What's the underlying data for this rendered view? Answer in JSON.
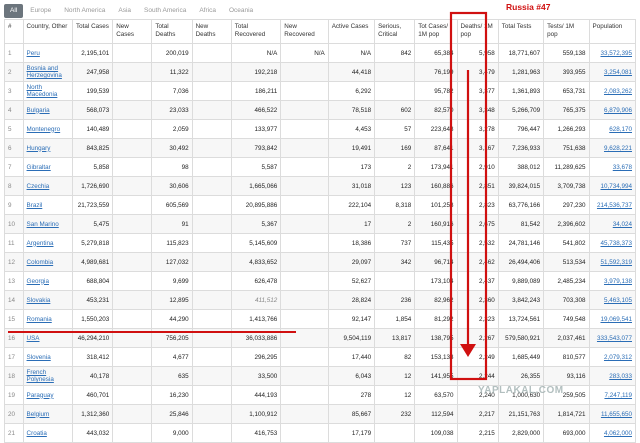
{
  "tabs": [
    {
      "label": "All",
      "active": true
    },
    {
      "label": "Europe"
    },
    {
      "label": "North America"
    },
    {
      "label": "Asia"
    },
    {
      "label": "South America"
    },
    {
      "label": "Africa"
    },
    {
      "label": "Oceania"
    }
  ],
  "annotation": {
    "label": "Russia #47",
    "color": "#d01010"
  },
  "watermark": "YAPLAKAL.COM",
  "table": {
    "headers": [
      "#",
      "Country, Other",
      "Total Cases",
      "New Cases",
      "Total Deaths",
      "New Deaths",
      "Total Recovered",
      "New Recovered",
      "Active Cases",
      "Serious, Critical",
      "Tot Cases/ 1M pop",
      "Deaths/ 1M pop",
      "Total Tests",
      "Tests/ 1M pop",
      "Population"
    ],
    "rows": [
      [
        "1",
        "Peru",
        "2,195,101",
        "",
        "200,019",
        "",
        "N/A",
        "N/A",
        "N/A",
        "842",
        "65,384",
        "5,958",
        "18,771,607",
        "559,138",
        "33,572,395"
      ],
      [
        "2",
        "Bosnia and Herzegovina",
        "247,958",
        "",
        "11,322",
        "",
        "192,218",
        "",
        "44,418",
        "",
        "76,199",
        "3,479",
        "1,281,963",
        "393,955",
        "3,254,081"
      ],
      [
        "3",
        "North Macedonia",
        "199,539",
        "",
        "7,036",
        "",
        "186,211",
        "",
        "6,292",
        "",
        "95,782",
        "3,377",
        "1,361,893",
        "653,731",
        "2,083,262"
      ],
      [
        "4",
        "Bulgaria",
        "568,073",
        "",
        "23,033",
        "",
        "466,522",
        "",
        "78,518",
        "602",
        "82,570",
        "3,348",
        "5,266,709",
        "765,375",
        "6,879,906"
      ],
      [
        "5",
        "Montenegro",
        "140,489",
        "",
        "2,059",
        "",
        "133,977",
        "",
        "4,453",
        "57",
        "223,648",
        "3,278",
        "796,447",
        "1,266,293",
        "628,170"
      ],
      [
        "6",
        "Hungary",
        "843,825",
        "",
        "30,492",
        "",
        "793,842",
        "",
        "19,491",
        "169",
        "87,641",
        "3,167",
        "7,236,933",
        "751,638",
        "9,628,221"
      ],
      [
        "7",
        "Gibraltar",
        "5,858",
        "",
        "98",
        "",
        "5,587",
        "",
        "173",
        "2",
        "173,941",
        "2,910",
        "388,012",
        "11,289,625",
        "33,678"
      ],
      [
        "8",
        "Czechia",
        "1,726,690",
        "",
        "30,606",
        "",
        "1,665,066",
        "",
        "31,018",
        "123",
        "160,886",
        "2,851",
        "39,824,015",
        "3,709,738",
        "10,734,994"
      ],
      [
        "9",
        "Brazil",
        "21,723,559",
        "",
        "605,569",
        "",
        "20,895,886",
        "",
        "222,104",
        "8,318",
        "101,258",
        "2,823",
        "63,776,166",
        "297,230",
        "214,536,737"
      ],
      [
        "10",
        "San Marino",
        "5,475",
        "",
        "91",
        "",
        "5,367",
        "",
        "17",
        "2",
        "160,916",
        "2,675",
        "81,542",
        "2,396,602",
        "34,024"
      ],
      [
        "11",
        "Argentina",
        "5,279,818",
        "",
        "115,823",
        "",
        "5,145,609",
        "",
        "18,386",
        "737",
        "115,435",
        "2,532",
        "24,781,146",
        "541,802",
        "45,738,373"
      ],
      [
        "12",
        "Colombia",
        "4,989,681",
        "",
        "127,032",
        "",
        "4,833,652",
        "",
        "29,097",
        "342",
        "96,714",
        "2,462",
        "26,494,406",
        "513,534",
        "51,592,319"
      ],
      [
        "13",
        "Georgia",
        "688,804",
        "",
        "9,699",
        "",
        "626,478",
        "",
        "52,627",
        "",
        "173,104",
        "2,437",
        "9,889,089",
        "2,485,234",
        "3,979,138"
      ],
      [
        "14",
        "Slovakia",
        "453,231",
        "",
        "12,895",
        "",
        "411,512",
        "",
        "28,824",
        "236",
        "82,962",
        "2,360",
        "3,842,243",
        "703,308",
        "5,463,105"
      ],
      [
        "15",
        "Romania",
        "1,550,203",
        "",
        "44,290",
        "",
        "1,413,766",
        "",
        "92,147",
        "1,854",
        "81,292",
        "2,323",
        "13,724,561",
        "749,548",
        "19,069,541"
      ],
      [
        "16",
        "USA",
        "46,294,210",
        "",
        "756,205",
        "",
        "36,033,886",
        "",
        "9,504,119",
        "13,817",
        "138,795",
        "2,267",
        "579,580,921",
        "2,037,461",
        "333,543,077"
      ],
      [
        "17",
        "Slovenia",
        "318,412",
        "",
        "4,677",
        "",
        "296,295",
        "",
        "17,440",
        "82",
        "153,133",
        "2,249",
        "1,685,449",
        "810,577",
        "2,079,312"
      ],
      [
        "18",
        "French Polynesia",
        "40,178",
        "",
        "635",
        "",
        "33,500",
        "",
        "6,043",
        "12",
        "141,955",
        "2,244",
        "26,355",
        "93,116",
        "283,033"
      ],
      [
        "19",
        "Paraguay",
        "460,701",
        "",
        "16,230",
        "",
        "444,193",
        "",
        "278",
        "12",
        "63,570",
        "2,240",
        "1,000,630",
        "259,505",
        "7,247,119"
      ],
      [
        "20",
        "Belgium",
        "1,312,360",
        "",
        "25,846",
        "",
        "1,100,912",
        "",
        "85,667",
        "232",
        "112,594",
        "2,217",
        "21,151,763",
        "1,814,721",
        "11,655,650"
      ],
      [
        "21",
        "Croatia",
        "443,032",
        "",
        "9,000",
        "",
        "416,753",
        "",
        "17,179",
        "",
        "109,038",
        "2,215",
        "2,829,000",
        "693,000",
        "4,062,000"
      ]
    ]
  }
}
